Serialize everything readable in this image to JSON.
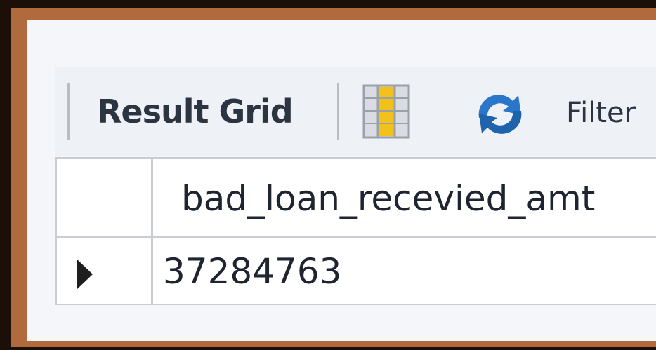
{
  "toolbar": {
    "result_grid_label": "Result Grid",
    "filter_label": "Filter",
    "icons": [
      "grid-layout-icon",
      "refresh-icon"
    ]
  },
  "result_table": {
    "columns": [
      "bad_loan_recevied_amt"
    ],
    "rows": [
      [
        "37284763"
      ]
    ],
    "selected_row_indicator": "row-pointer-icon"
  },
  "colors": {
    "frame_border": "#b06a3e",
    "outer_background": "#1b0f08",
    "grid_icon_fill": "#f2c21b",
    "refresh_icon_blue": "#2a76c9"
  }
}
